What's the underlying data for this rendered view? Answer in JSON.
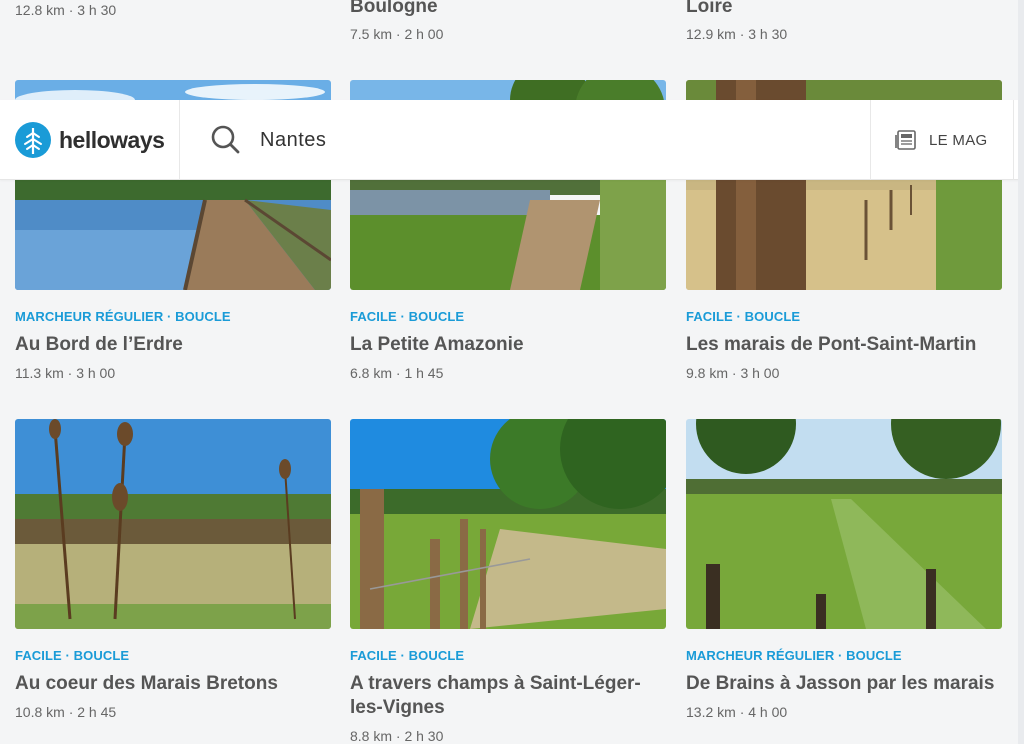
{
  "header": {
    "logo_text": "helloways",
    "search_value": "Nantes",
    "mag_label": "LE MAG"
  },
  "top_row": [
    {
      "meta": "12.8 km · 3 h 30"
    },
    {
      "title": "Boulogne",
      "meta": "7.5 km · 2 h 00"
    },
    {
      "title": "Loire",
      "meta": "12.9 km · 3 h 30"
    }
  ],
  "cards": [
    {
      "tags": "MARCHEUR RÉGULIER · BOUCLE",
      "title": "Au Bord de l’Erdre",
      "meta": "11.3 km · 3 h 00"
    },
    {
      "tags": "FACILE · BOUCLE",
      "title": "La Petite Amazonie",
      "meta": "6.8 km · 1 h 45"
    },
    {
      "tags": "FACILE · BOUCLE",
      "title": "Les marais de Pont-Saint-Martin",
      "meta": "9.8 km · 3 h 00"
    },
    {
      "tags": "FACILE · BOUCLE",
      "title": "Au coeur des Marais Bretons",
      "meta": "10.8 km · 2 h 45"
    },
    {
      "tags": "FACILE · BOUCLE",
      "title": "A travers champs à Saint-Léger-les-Vignes",
      "meta": "8.8 km · 2 h 30"
    },
    {
      "tags": "MARCHEUR RÉGULIER · BOUCLE",
      "title": "De Brains à Jasson par les marais",
      "meta": "13.2 km · 4 h 00"
    }
  ],
  "colors": {
    "accent": "#1a9bd7",
    "title": "#555555",
    "meta": "#666666",
    "background": "#f4f5f6"
  },
  "icons": [
    "tree-logo-icon",
    "search-icon",
    "newspaper-icon"
  ]
}
